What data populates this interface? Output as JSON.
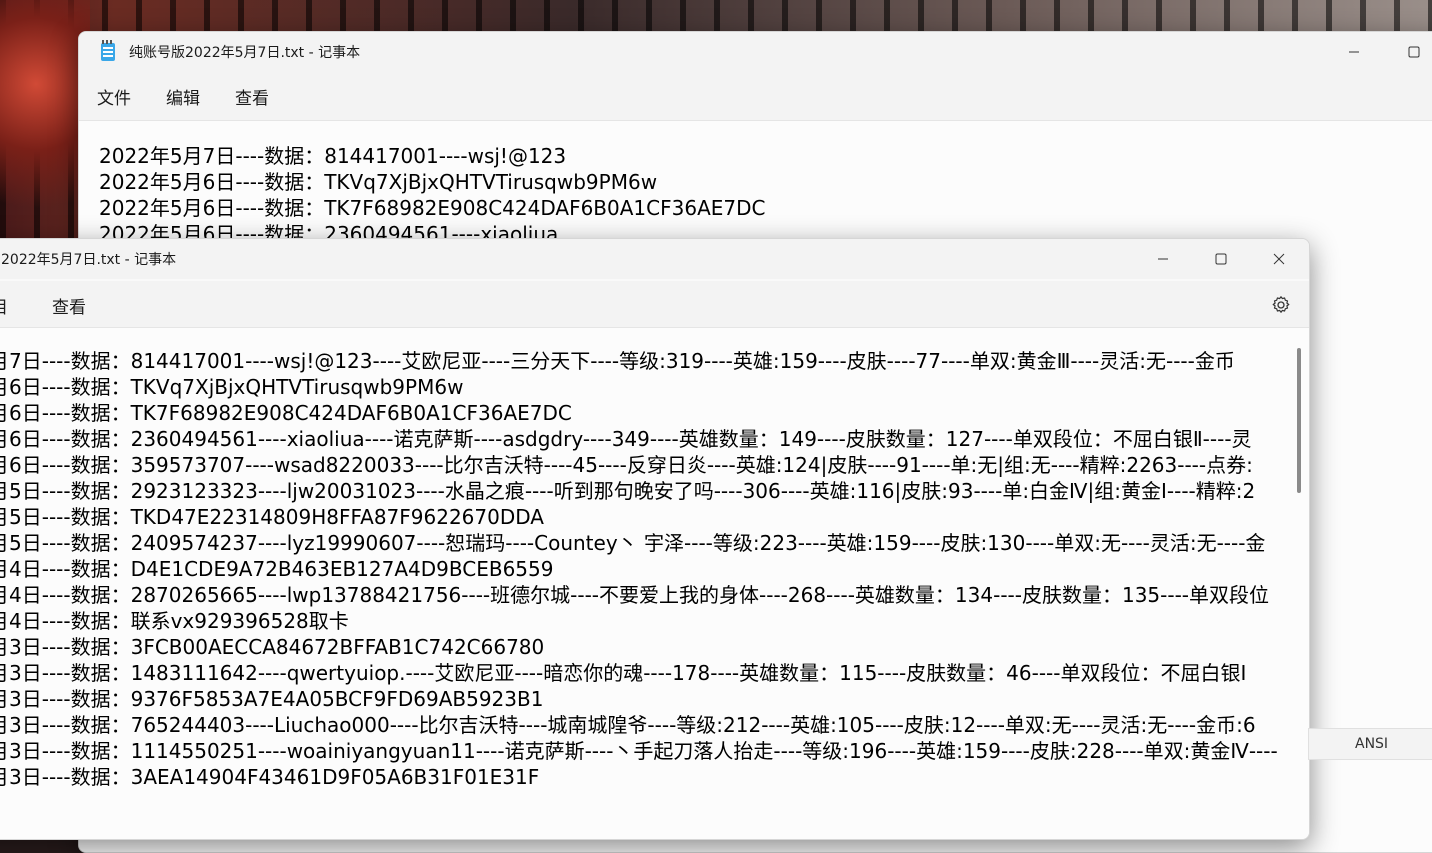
{
  "back_window": {
    "title": "纯账号版2022年5月7日.txt - 记事本",
    "menu": [
      "文件",
      "编辑",
      "查看"
    ],
    "lines": [
      "2022年5月7日----数据：814417001----wsj!@123",
      "2022年5月6日----数据：TKVq7XjBjxQHTVTirusqwb9PM6w",
      "2022年5月6日----数据：TK7F68982E908C424DAF6B0A1CF36AE7DC",
      "2022年5月6日----数据：2360494561----xiaoliua"
    ]
  },
  "front_window": {
    "title": "2022年5月7日.txt - 记事本",
    "menu": [
      "编辑",
      "查看"
    ],
    "menu_display": [
      "目",
      "查看"
    ],
    "lines": [
      "月7日----数据：814417001----wsj!@123----艾欧尼亚----三分天下----等级:319----英雄:159----皮肤----77----单双:黄金Ⅲ----灵活:无----金币",
      "月6日----数据：TKVq7XjBjxQHTVTirusqwb9PM6w",
      "月6日----数据：TK7F68982E908C424DAF6B0A1CF36AE7DC",
      "月6日----数据：2360494561----xiaoliua----诺克萨斯----asdgdry----349----英雄数量：149----皮肤数量：127----单双段位：不屈白银Ⅱ----灵",
      "月6日----数据：359573707----wsad8220033----比尔吉沃特----45----反穿日炎----英雄:124|皮肤----91----单:无|组:无----精粹:2263----点券:",
      "月5日----数据：2923123323----ljw20031023----水晶之痕----听到那句晚安了吗----306----英雄:116|皮肤:93----单:白金Ⅳ|组:黄金Ⅰ----精粹:2",
      "月5日----数据：TKD47E22314809H8FFA87F9622670DDA",
      "月5日----数据：2409574237----lyz19990607----恕瑞玛----Countey丶 宇泽----等级:223----英雄:159----皮肤:130----单双:无----灵活:无----金",
      "月4日----数据：D4E1CDE9A72B463EB127A4D9BCEB6559",
      "月4日----数据：2870265665----lwp13788421756----班德尔城----不要爱上我的身体----268----英雄数量：134----皮肤数量：135----单双段位",
      "月4日----数据：联系vx929396528取卡",
      "月3日----数据：3FCB00AECCA84672BFFAB1C742C66780",
      "月3日----数据：1483111642----qwertyuiop.----艾欧尼亚----暗恋你的魂----178----英雄数量：115----皮肤数量：46----单双段位：不屈白银Ⅰ",
      "月3日----数据：9376F5853A7E4A05BCF9FD69AB5923B1",
      "月3日----数据：765244403----Liuchao000----比尔吉沃特----城南城隍爷----等级:212----英雄:105----皮肤:12----单双:无----灵活:无----金币:6",
      "月3日----数据：1114550251----woainiyangyuan11----诺克萨斯----丶手起刀落人抬走----等级:196----英雄:159----皮肤:228----单双:黄金Ⅳ----",
      "月3日----数据：3AEA14904F43461D9F05A6B31F01E31F"
    ]
  },
  "status": {
    "encoding": "ANSI"
  },
  "icons": {
    "notepad": "notepad-icon",
    "minimize": "minimize-icon",
    "maximize": "maximize-icon",
    "close": "close-icon",
    "settings": "gear-icon"
  }
}
